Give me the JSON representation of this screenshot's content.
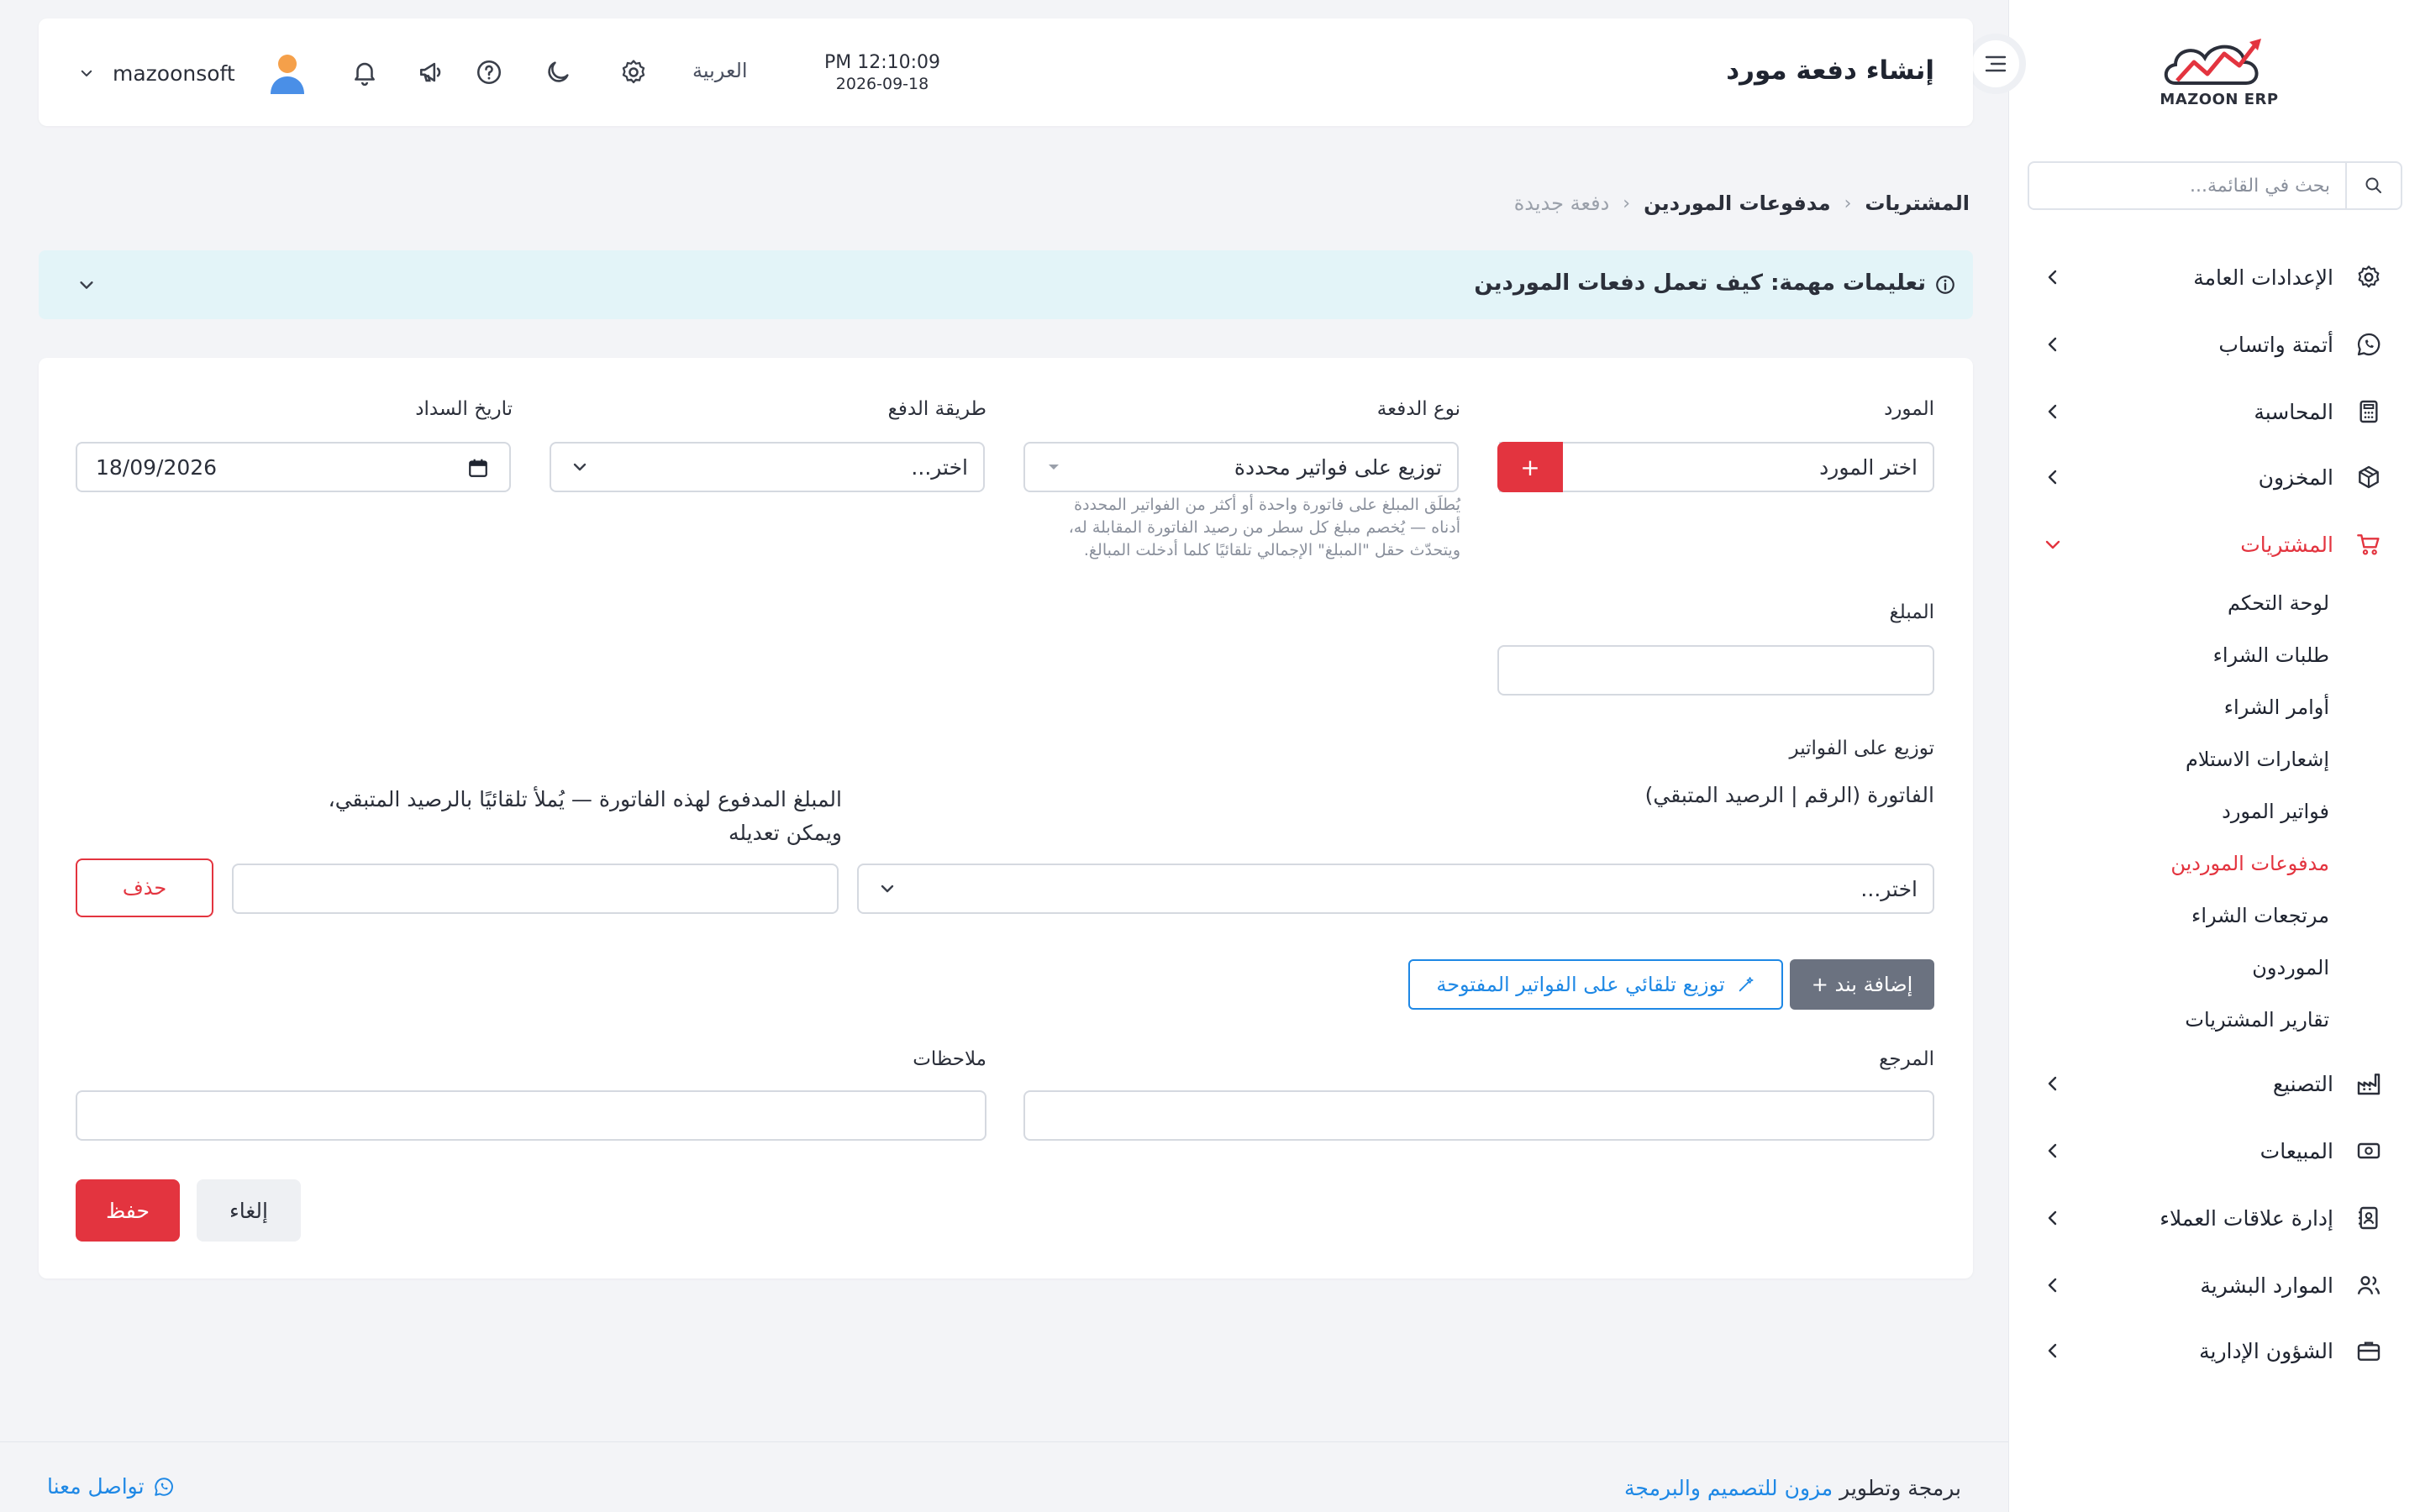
{
  "sidebar": {
    "logo_text": "MAZOON ERP",
    "search_placeholder": "بحث في القائمة...",
    "menu": [
      {
        "label": "الإعدادات العامة",
        "icon": "gear-icon"
      },
      {
        "label": "أتمتة واتساب",
        "icon": "whatsapp-icon"
      },
      {
        "label": "المحاسبة",
        "icon": "calculator-icon"
      },
      {
        "label": "المخزون",
        "icon": "box-icon"
      },
      {
        "label": "المشتريات",
        "icon": "cart-icon",
        "active": true
      },
      {
        "label": "التصنيع",
        "icon": "factory-icon"
      },
      {
        "label": "المبيعات",
        "icon": "cash-icon"
      },
      {
        "label": "إدارة علاقات العملاء",
        "icon": "contacts-icon"
      },
      {
        "label": "الموارد البشرية",
        "icon": "users-icon"
      },
      {
        "label": "الشؤون الإدارية",
        "icon": "briefcase-icon"
      }
    ],
    "submenu": [
      {
        "label": "لوحة التحكم"
      },
      {
        "label": "طلبات الشراء"
      },
      {
        "label": "أوامر الشراء"
      },
      {
        "label": "إشعارات الاستلام"
      },
      {
        "label": "فواتير المورد"
      },
      {
        "label": "مدفوعات الموردين",
        "active": true
      },
      {
        "label": "مرتجعات الشراء"
      },
      {
        "label": "الموردون"
      },
      {
        "label": "تقارير المشتريات"
      }
    ]
  },
  "header": {
    "title": "إنشاء دفعة مورد",
    "time": "PM 12:10:09",
    "date": "2026-09-18",
    "language": "العربية",
    "username": "mazoonsoft"
  },
  "breadcrumb": [
    "المشتريات",
    "مدفوعات الموردين",
    "دفعة جديدة"
  ],
  "notice": {
    "text": "تعليمات مهمة: كيف تعمل دفعات الموردين"
  },
  "form": {
    "supplier": {
      "label": "المورد",
      "value": "اختر المورد",
      "add_label": "+"
    },
    "payment_type": {
      "label": "نوع الدفعة",
      "value": "توزيع على فواتير محددة",
      "help": [
        "يُطلَق المبلغ على فاتورة واحدة أو أكثر من الفواتير المحددة",
        "أدناه — يُخصم مبلغ كل سطر من رصيد الفاتورة المقابلة له،",
        "ويتحدّث حقل \"المبلغ\" الإجمالي تلقائيًا كلما أدخلت المبالغ."
      ]
    },
    "payment_method": {
      "label": "طريقة الدفع",
      "value": "اختر..."
    },
    "payment_date": {
      "label": "تاريخ السداد",
      "value": "18/09/2026"
    },
    "amount": {
      "label": "المبلغ",
      "value": ""
    },
    "distribution": {
      "label": "توزيع على الفواتير",
      "invoice_header": "الفاتورة (الرقم | الرصيد المتبقي)",
      "amount_header_line1": "المبلغ المدفوع لهذه الفاتورة — يُملأ تلقائيًا بالرصيد المتبقي،",
      "amount_header_line2": "ويمكن تعديله",
      "row_invoice_value": "اختر...",
      "row_amount_value": "",
      "delete_label": "حذف"
    },
    "add_line_label": "+ إضافة بند",
    "auto_distribute_label": "توزيع تلقائي على الفواتير المفتوحة",
    "reference": {
      "label": "المرجع",
      "value": ""
    },
    "notes": {
      "label": "ملاحظات",
      "value": ""
    },
    "cancel_label": "إلغاء",
    "save_label": "حفظ"
  },
  "footer": {
    "credit_prefix": "برمجة وتطوير",
    "credit_link": "مزون للتصميم والبرمجة",
    "contact": "تواصل معنا"
  },
  "colors": {
    "accent": "#e3343f",
    "link": "#1e88e5",
    "notice_bg": "#e3f4f8",
    "secondary_button": "#6b7280"
  }
}
